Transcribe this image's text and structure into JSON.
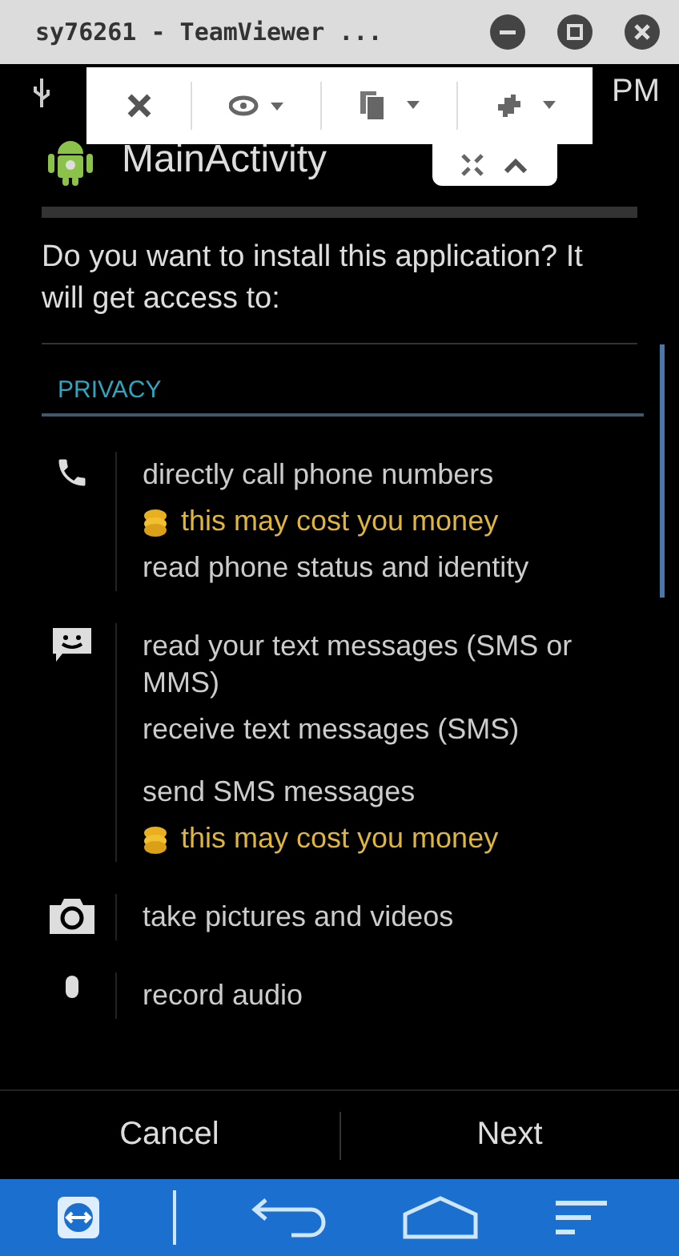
{
  "window": {
    "title": "sy76261 - TeamViewer ..."
  },
  "status_bar": {
    "time": "PM"
  },
  "app_bar": {
    "title": "MainActivity"
  },
  "prompt": "Do you want to install this application? It will get access to:",
  "section": {
    "title": "PRIVACY"
  },
  "permissions": [
    {
      "kind": "phone",
      "lines": [
        {
          "kind": "normal",
          "text": "directly call phone numbers"
        },
        {
          "kind": "cost",
          "text": "this may cost you money"
        },
        {
          "kind": "normal",
          "text": "read phone status and identity"
        }
      ]
    },
    {
      "kind": "message",
      "lines": [
        {
          "kind": "normal",
          "text": "read your text messages (SMS or MMS)"
        },
        {
          "kind": "normal",
          "text": "receive text messages (SMS)"
        },
        {
          "kind": "gap",
          "text": "send SMS messages"
        },
        {
          "kind": "cost",
          "text": "this may cost you money"
        }
      ]
    },
    {
      "kind": "camera",
      "lines": [
        {
          "kind": "normal",
          "text": "take pictures and videos"
        }
      ]
    },
    {
      "kind": "mic",
      "lines": [
        {
          "kind": "normal",
          "text": "record audio"
        }
      ]
    }
  ],
  "buttons": [
    {
      "label": "Cancel"
    },
    {
      "label": "Next"
    }
  ]
}
